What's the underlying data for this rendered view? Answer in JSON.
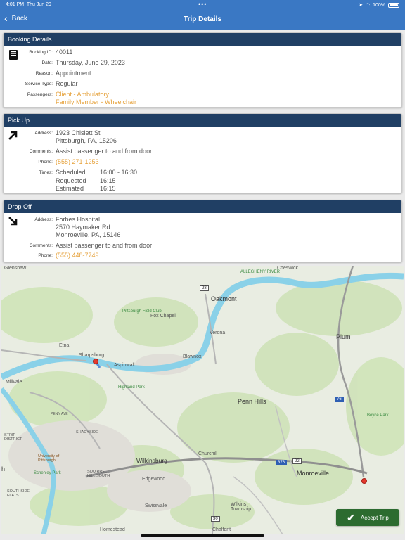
{
  "status_bar": {
    "time": "4:01 PM",
    "date": "Thu Jun 29",
    "dots": "•••",
    "battery": "100%"
  },
  "nav": {
    "back_label": "Back",
    "title": "Trip Details"
  },
  "booking": {
    "header": "Booking Details",
    "booking_id_label": "Booking ID:",
    "booking_id": "40011",
    "date_label": "Date:",
    "date": "Thursday, June 29, 2023",
    "reason_label": "Reason:",
    "reason": "Appointment",
    "service_type_label": "Service Type:",
    "service_type": "Regular",
    "passengers_label": "Passengers:",
    "passengers": [
      "Client - Ambulatory",
      "Family Member - Wheelchair"
    ]
  },
  "pickup": {
    "header": "Pick Up",
    "address_label": "Address:",
    "address_line1": "1923 Chislett St",
    "address_line2": "Pittsburgh, PA, 15206",
    "comments_label": "Comments:",
    "comments": "Assist passenger to and from door",
    "phone_label": "Phone:",
    "phone": "(555) 271-1253",
    "times_label": "Times:",
    "times": [
      {
        "name": "Scheduled",
        "value": "16:00 - 16:30"
      },
      {
        "name": "Requested",
        "value": "16:15"
      },
      {
        "name": "Estimated",
        "value": "16:15"
      }
    ]
  },
  "dropoff": {
    "header": "Drop Off",
    "address_label": "Address:",
    "address_line1": "Forbes Hospital",
    "address_line2": "2570 Haymaker Rd",
    "address_line3": "Monroeville, PA, 15146",
    "comments_label": "Comments:",
    "comments": "Assist passenger to and from door",
    "phone_label": "Phone:",
    "phone": "(555) 448-7749"
  },
  "map": {
    "labels": {
      "glenshaw": "Glenshaw",
      "cheswick": "Cheswick",
      "oakmont": "Oakmont",
      "fox_chapel": "Fox Chapel",
      "verona": "Verona",
      "plum": "Plum",
      "etna": "Etna",
      "sharpsburg": "Sharpsburg",
      "aspinwall": "Aspinwall",
      "blawnox": "Blawnox",
      "millvale": "Millvale",
      "highland_park": "Highland Park",
      "penn_hills": "Penn Hills",
      "boyce_park": "Boyce Park",
      "strip_district": "STRIP DISTRICT",
      "shadyside": "SHADYSIDE",
      "university": "University of Pittsburgh",
      "schenley_park": "Schenley Park",
      "squirrel_hill": "SQUIRREL HILL SOUTH",
      "wilkinsburg": "Wilkinsburg",
      "churchill": "Churchill",
      "monroeville": "Monroeville",
      "edgewood": "Edgewood",
      "southside_flats": "SOUTHSIDE FLATS",
      "swissvale": "Swissvale",
      "wilkins": "Wilkins Township",
      "homestead": "Homestead",
      "chalfant": "Chalfant",
      "pittsburgh_field_club": "Pittsburgh Field Club",
      "penn_ave": "PENN AVE",
      "allegheny_river": "ALLEGHENY RIVER",
      "h": "h"
    },
    "shields": {
      "s28": "28",
      "s76": "76",
      "s376": "376",
      "s22": "22",
      "s30": "30"
    }
  },
  "accept_label": "Accept Trip"
}
